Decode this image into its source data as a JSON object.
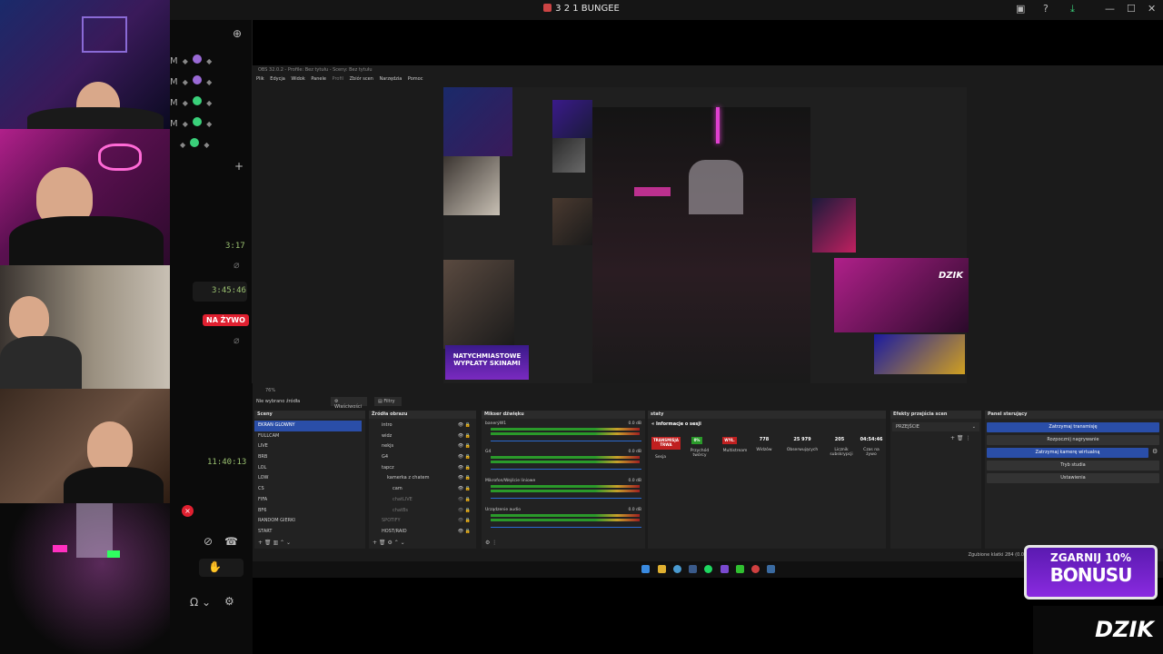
{
  "window": {
    "title": "3 2 1 BUNGEE",
    "controls": [
      "—",
      "☐",
      "✕"
    ]
  },
  "chat": {
    "members": [
      {
        "letter": "M",
        "status": "#9a6ad6"
      },
      {
        "letter": "M",
        "status": "#9a6ad6"
      },
      {
        "letter": "M",
        "status": "#3ad07a"
      },
      {
        "letter": "M",
        "status": "#3ad07a"
      },
      {
        "letter": "",
        "status": "#3ad07a"
      }
    ],
    "timestamps": [
      "3:17",
      "3:45:46",
      "11:40:13"
    ],
    "live_badge": "NA ŻYWO"
  },
  "obs": {
    "title": "OBS 32.0.2 - Profile: Bez tytułu - Sceny: Bez tytułu",
    "menu": [
      "Plik",
      "Edycja",
      "Widok",
      "Panele",
      "Profil",
      "Zbiór scen",
      "Narzędzia",
      "Pomoc"
    ],
    "zoom": "76%",
    "source_hint": "Nie wybrano źródła",
    "props_label": "Właściwości",
    "filters_label": "Filtry",
    "docks": {
      "scenes": "Sceny",
      "sources": "Źródła obrazu",
      "mixer": "Mikser dźwięku",
      "stats": "staty",
      "transitions": "Efekty przejścia scen",
      "controls": "Panel sterujący"
    },
    "scenes": [
      "EKRAN GLOWNY",
      "FULLCAM",
      "LIVE",
      "BRB",
      "LOL",
      "LOW",
      "CS",
      "FIFA",
      "BF6",
      "RANDOM GIERKI",
      "START"
    ],
    "sources": [
      "intro",
      "widz",
      "nekjs",
      "G4",
      "tapcz",
      "kamerka z chatem",
      "cam",
      "chatLIVE",
      "chatBs",
      "SPOTIFY",
      "HOST/RAID"
    ],
    "mixer": [
      {
        "name": "banerýW1",
        "db": "0.0 dB"
      },
      {
        "name": "G4",
        "db": "0.0 dB"
      },
      {
        "name": "Mikrofon/Wejście liniowe",
        "db": "0.0 dB"
      },
      {
        "name": "Urządzenie audio",
        "db": "0.0 dB"
      }
    ],
    "stats_title": "Informacje o sesji",
    "stats": [
      {
        "badge": "TRANSMISJA TRWA",
        "label": "Sesja",
        "color": "#c02020"
      },
      {
        "badge": "0%",
        "label": "Przychód twórcy",
        "color": "#2a9a2a"
      },
      {
        "badge": "WYŁ.",
        "label": "Multistream",
        "color": "#c02020"
      }
    ],
    "numbers": [
      {
        "value": "778",
        "label": "Widzów"
      },
      {
        "value": "25 979",
        "label": "Obserwujących"
      },
      {
        "value": "205",
        "label": "Licznik subskrypcji"
      },
      {
        "value": "04:54:46",
        "label": "Czas na żywo"
      }
    ],
    "transition": "PRZEJŚCIE",
    "controls": [
      "Zatrzymaj transmisję",
      "Rozpocznij nagrywanie",
      "Zatrzymaj kamerę wirtualną",
      "Tryb studia",
      "Ustawienia"
    ],
    "status_text": "Zgubione klatki 284 (0.0%)   7834 kb/s"
  },
  "promo": {
    "scene_promo_top": "NATYCHMIASTOWE",
    "scene_promo_bottom": "WYPŁATY SKINAMI",
    "dzik_small": "DZIK",
    "bonus_top": "ZGARNIJ 10%",
    "bonus_main": "BONUSU",
    "dzik": "DZIK"
  }
}
